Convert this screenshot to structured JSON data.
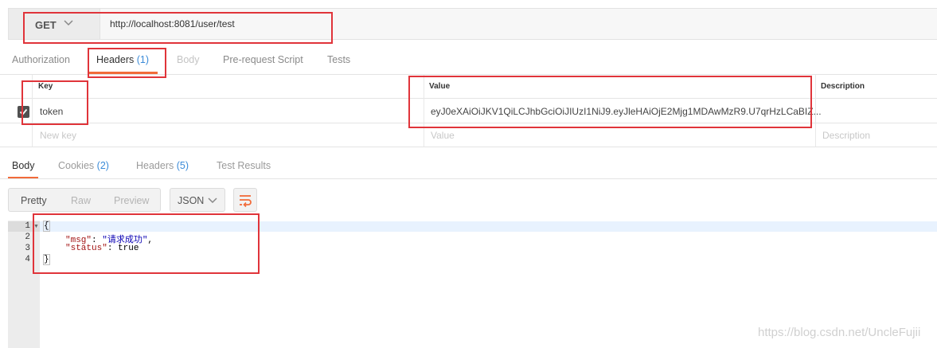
{
  "request": {
    "method": "GET",
    "url": "http://localhost:8081/user/test"
  },
  "request_tabs": [
    {
      "label": "Authorization"
    },
    {
      "label": "Headers",
      "count": "(1)"
    },
    {
      "label": "Body"
    },
    {
      "label": "Pre-request Script"
    },
    {
      "label": "Tests"
    }
  ],
  "headers_table": {
    "columns": [
      "Key",
      "Value",
      "Description"
    ],
    "rows": [
      {
        "key": "token",
        "value": "eyJ0eXAiOiJKV1QiLCJhbGciOiJIUzI1NiJ9.eyJleHAiOjE2Mjg1MDAwMzR9.U7qrHzLCaBIZ...",
        "description": "",
        "checked": true
      }
    ],
    "placeholders": {
      "key": "New key",
      "value": "Value",
      "description": "Description"
    }
  },
  "response_tabs": [
    {
      "label": "Body"
    },
    {
      "label": "Cookies",
      "count": "(2)"
    },
    {
      "label": "Headers",
      "count": "(5)"
    },
    {
      "label": "Test Results"
    }
  ],
  "view_modes": [
    "Pretty",
    "Raw",
    "Preview"
  ],
  "format": "JSON",
  "response_body": {
    "line_numbers": [
      "1",
      "2",
      "3",
      "4"
    ],
    "open_brace": "{",
    "close_brace": "}",
    "msg_key": "\"msg\"",
    "msg_value": "\"请求成功\"",
    "status_key": "\"status\"",
    "status_value": "true"
  },
  "watermark": "https://blog.csdn.net/UncleFujii",
  "colors": {
    "accent": "#f26b3a",
    "count_blue": "#3b8bd8",
    "annotation_red": "#e0343a"
  }
}
